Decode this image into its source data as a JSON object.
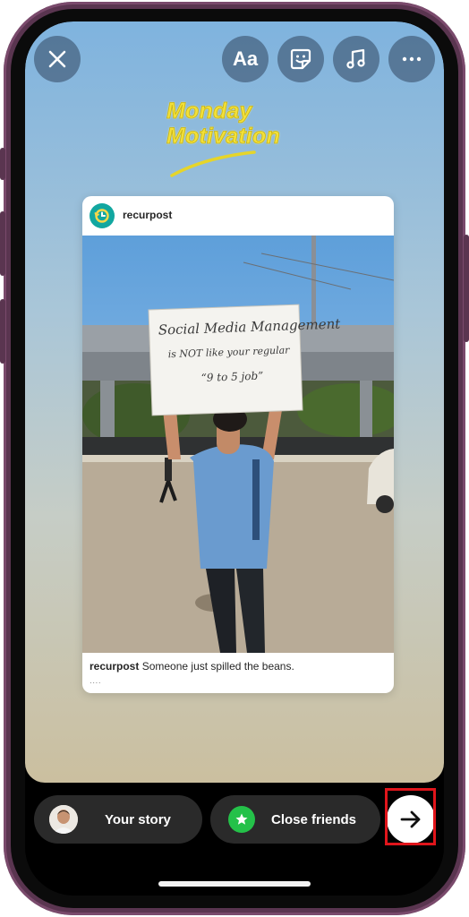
{
  "toolbar": {
    "close": "close-icon",
    "text": "Aa",
    "sticker": "sticker-icon",
    "music": "music-icon",
    "more": "more-icon"
  },
  "sticker": {
    "line1": "Monday",
    "line2": "Motivation",
    "color": "#f2e03a"
  },
  "post": {
    "username": "recurpost",
    "caption_user": "recurpost",
    "caption_text": " Someone just spilled the beans.",
    "more": "....",
    "sign_text": [
      "Social Media Management",
      "is NOT like your regular",
      "“9 to 5 job”"
    ]
  },
  "share": {
    "your_story": "Your story",
    "close_friends": "Close friends",
    "close_friends_color": "#24c149",
    "highlight_color": "#e0151b"
  }
}
